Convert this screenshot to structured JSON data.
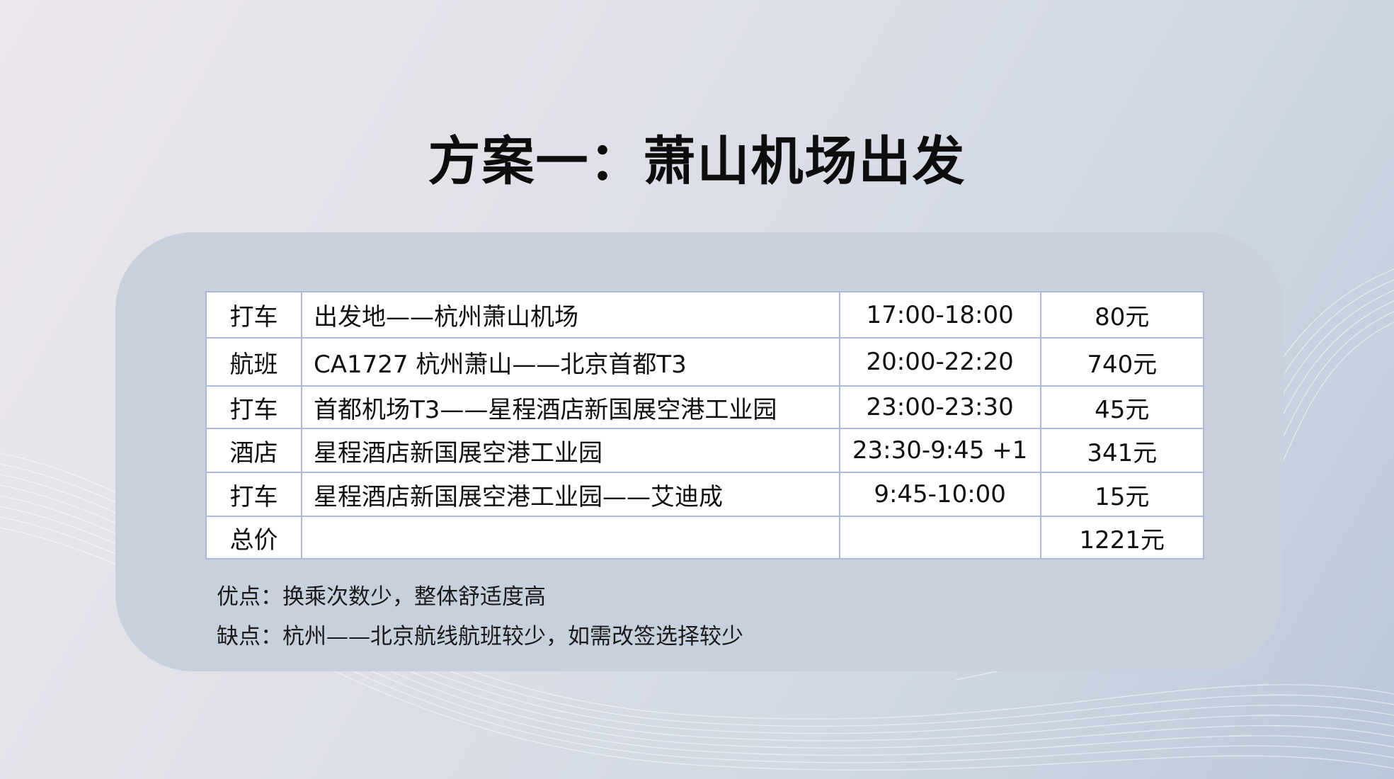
{
  "title": "方案一：萧山机场出发",
  "table": {
    "rows": [
      {
        "type": "打车",
        "route": "出发地——杭州萧山机场",
        "time": "17:00-18:00",
        "price": "80元"
      },
      {
        "type": "航班",
        "route": "CA1727 杭州萧山——北京首都T3",
        "time": "20:00-22:20",
        "price": "740元"
      },
      {
        "type": "打车",
        "route": "首都机场T3——星程酒店新国展空港工业园",
        "time": "23:00-23:30",
        "price": "45元"
      },
      {
        "type": "酒店",
        "route": "星程酒店新国展空港工业园",
        "time": "23:30-9:45 +1",
        "price": "341元"
      },
      {
        "type": "打车",
        "route": "星程酒店新国展空港工业园——艾迪成",
        "time": "9:45-10:00",
        "price": "15元"
      },
      {
        "type": "总价",
        "route": "",
        "time": "",
        "price": "1221元"
      }
    ]
  },
  "notes": {
    "pros": "优点：换乘次数少，整体舒适度高",
    "cons": "缺点：杭州——北京航线航班较少，如需改签选择较少"
  },
  "colors": {
    "table_border": "#3d61ae",
    "panel": "#c8d0dd"
  }
}
